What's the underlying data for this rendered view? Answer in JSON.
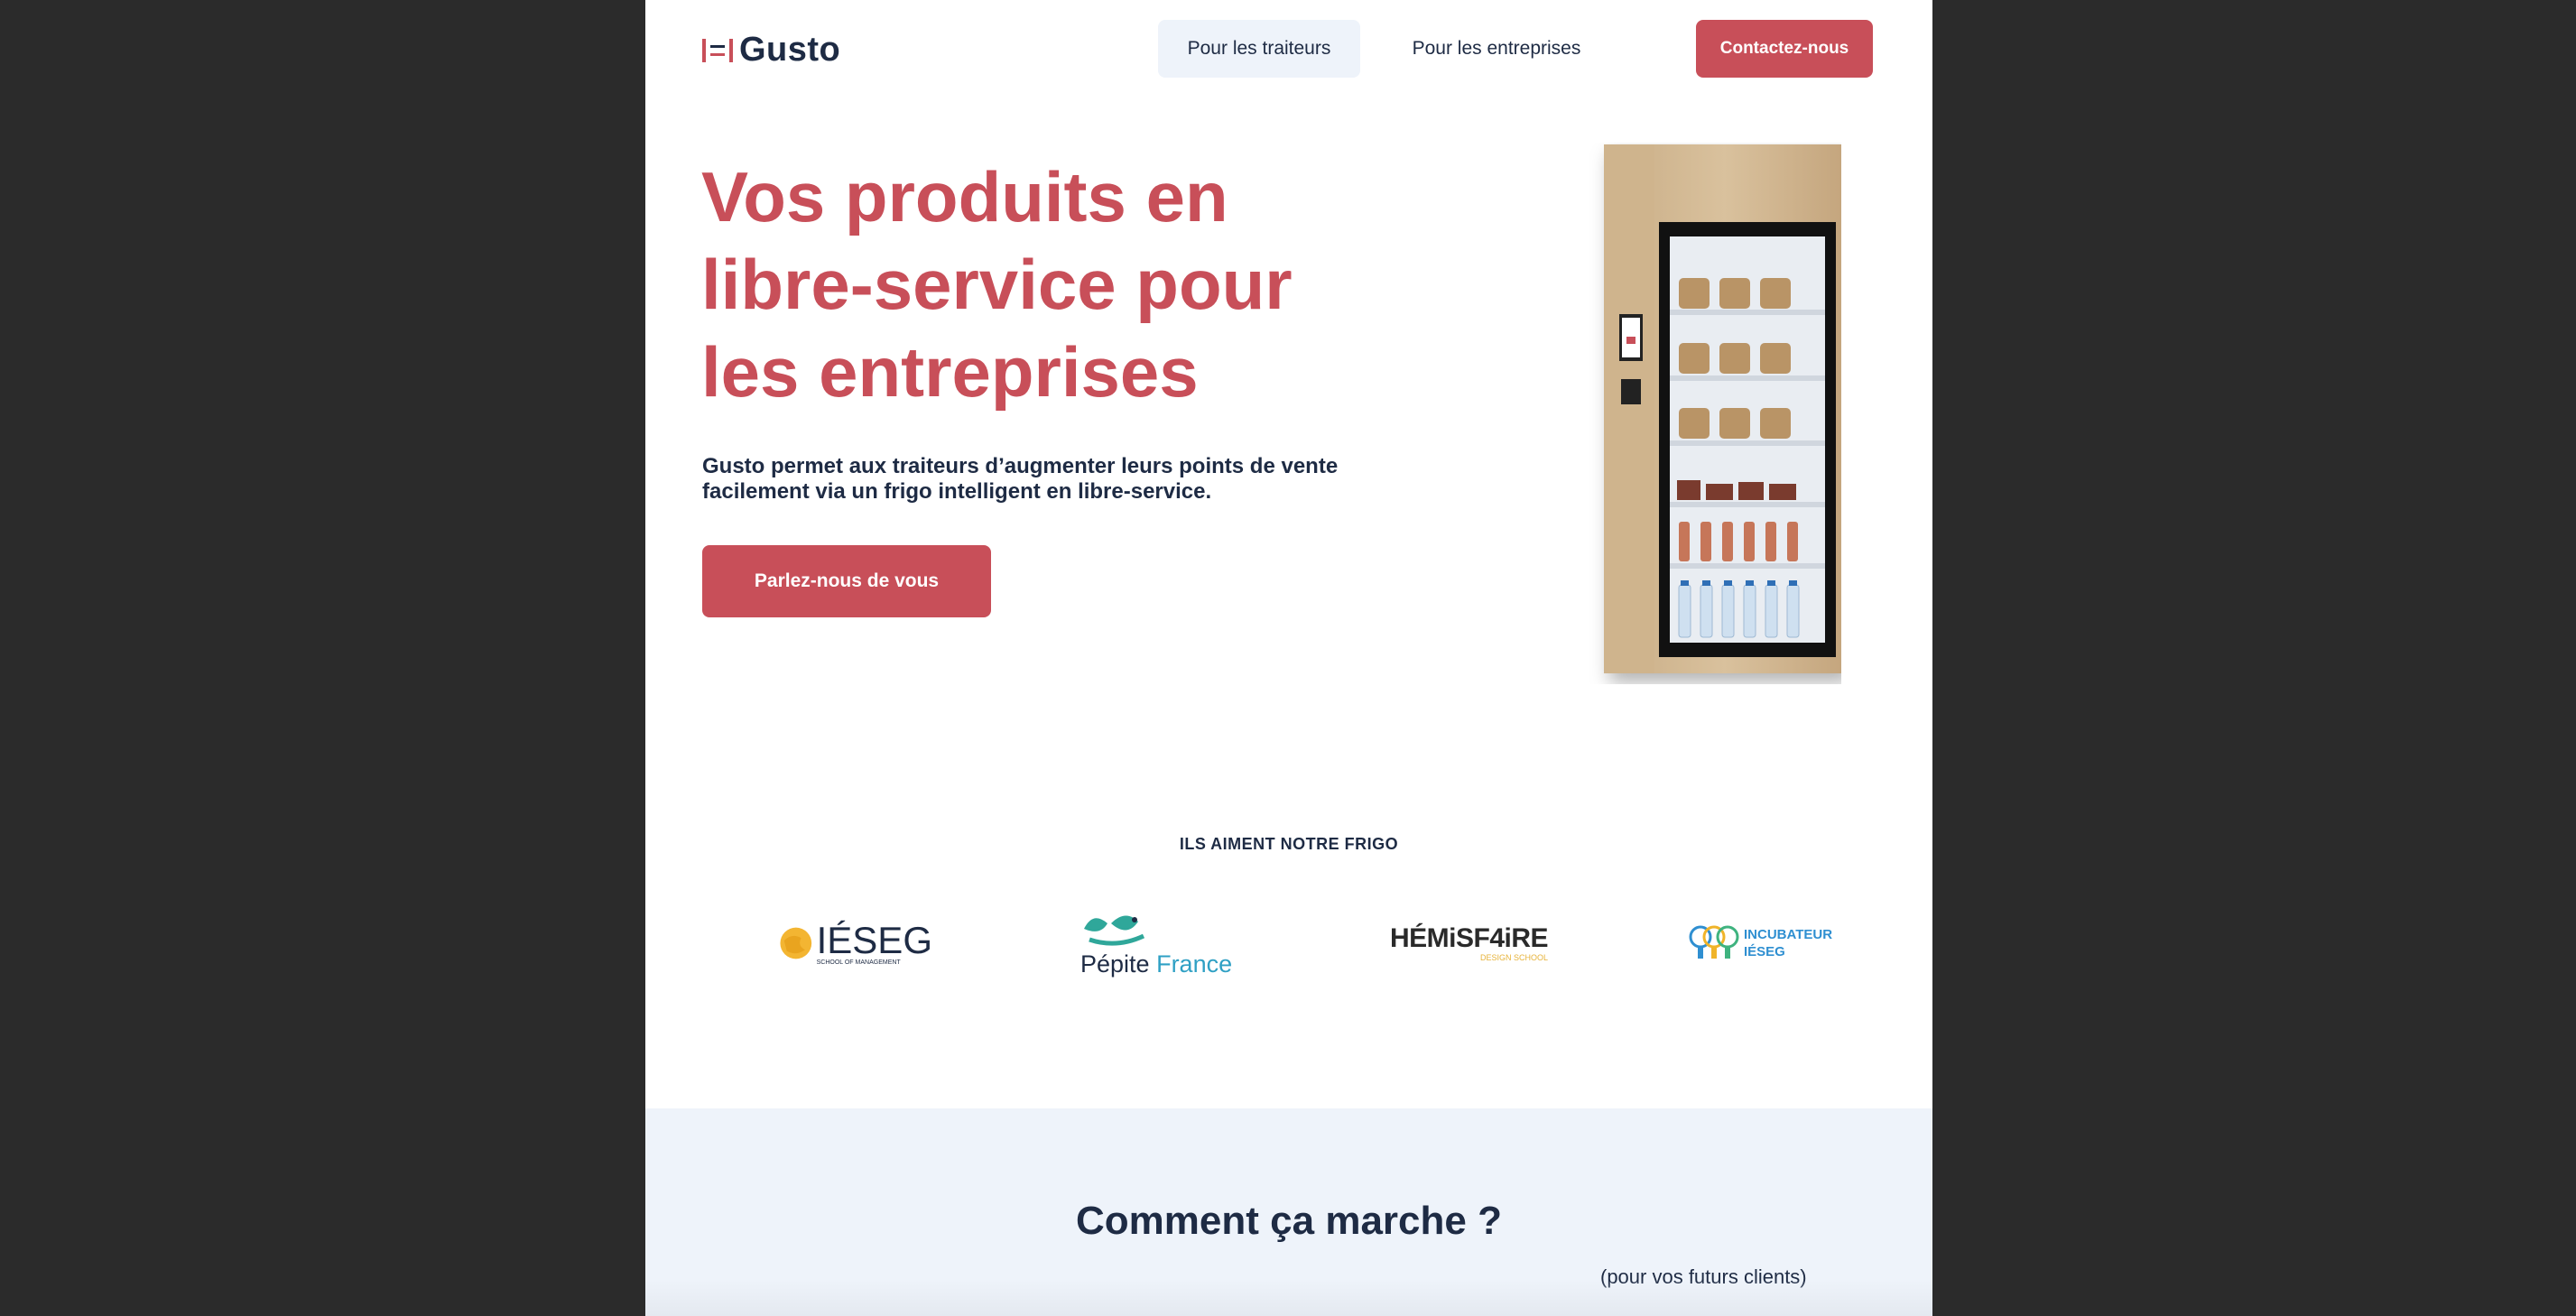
{
  "header": {
    "brand": "Gusto",
    "nav": {
      "traiteurs": "Pour les traiteurs",
      "entreprises": "Pour les entreprises",
      "contact": "Contactez-nous"
    }
  },
  "hero": {
    "title": "Vos produits en libre-service pour les entreprises",
    "subtitle": "Gusto permet aux traiteurs d’augmenter leurs points de vente facilement via un frigo intelligent en libre-service.",
    "cta": "Parlez-nous de vous"
  },
  "partners": {
    "heading": "ILS AIMENT NOTRE FRIGO",
    "ieseg": {
      "name": "IÉSEG",
      "tagline": "SCHOOL OF MANAGEMENT"
    },
    "pepite": {
      "word1": "Pépite",
      "word2": "France"
    },
    "hemisf4ire": {
      "name": "HÉMiSF4iRE",
      "tagline": "DESIGN SCHOOL"
    },
    "incubateur": {
      "line1": "INCUBATEUR",
      "line2": "IÉSEG"
    }
  },
  "how": {
    "title": "Comment ça marche ?",
    "subtitle": "(pour vos futurs clients)"
  },
  "colors": {
    "accent": "#c84f59",
    "navy": "#1e2b44",
    "light_bg": "#eef3fa",
    "outer_bg": "#2b2b2b"
  }
}
